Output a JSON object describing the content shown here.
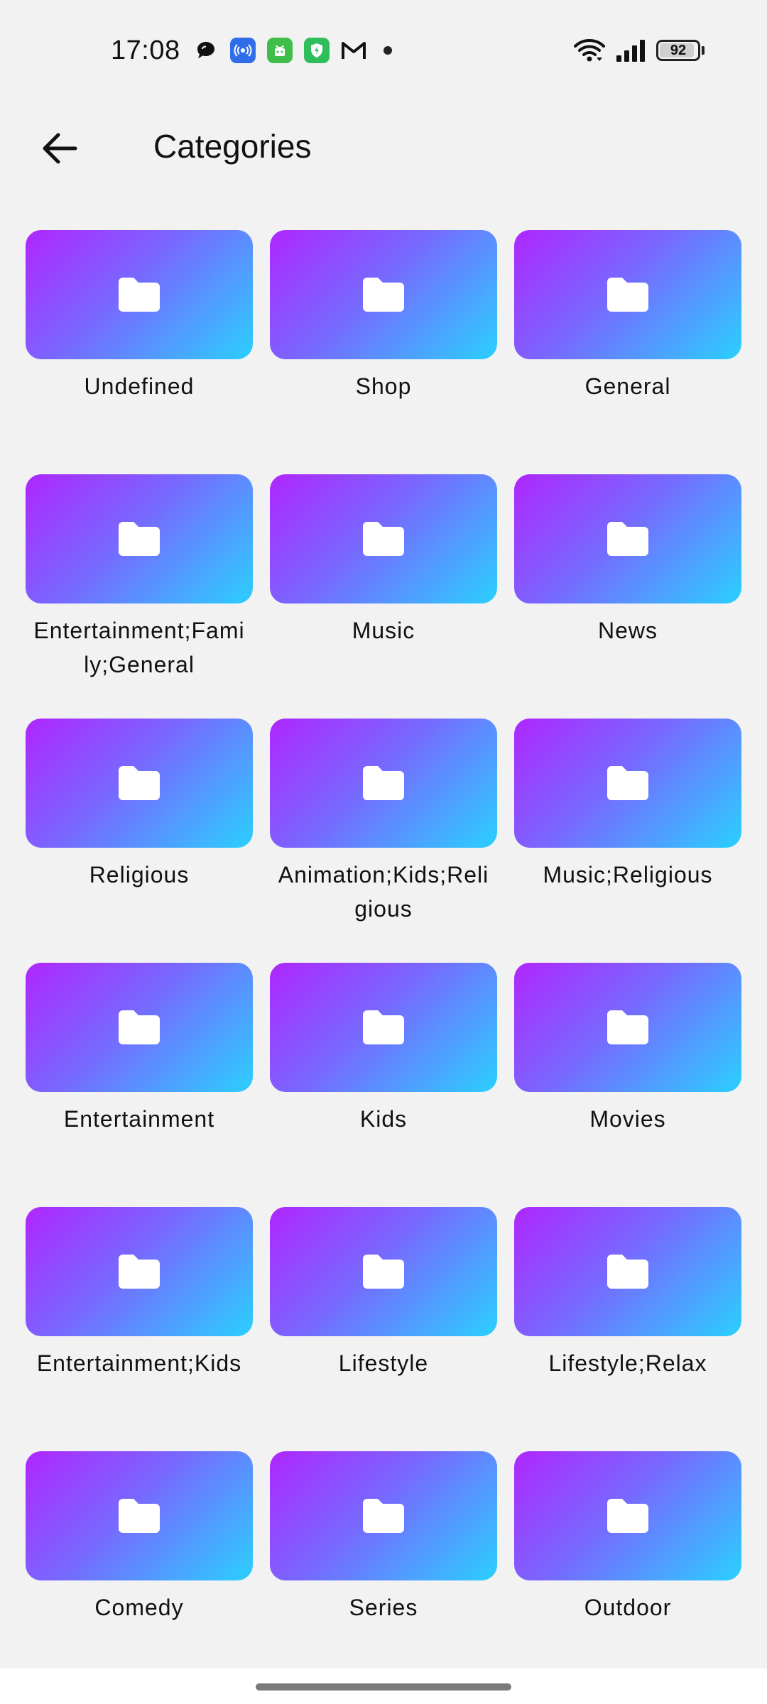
{
  "status_bar": {
    "time": "17:08",
    "battery": "92",
    "battery_level": 0.92,
    "notification_icons": [
      "chat-bubble-icon",
      "broadcast-icon",
      "store-bag-icon",
      "shield-bolt-icon",
      "gmail-icon",
      "more-dot-icon"
    ],
    "system_icons": [
      "wifi-icon",
      "signal-icon",
      "battery-icon"
    ]
  },
  "app_bar": {
    "back_icon": "arrow-left-icon",
    "title": "Categories"
  },
  "theme": {
    "background": "#f2f2f2",
    "gradient_start": "#b026ff",
    "gradient_mid": "#7769ff",
    "gradient_end": "#2ad0ff",
    "folder_icon_color": "#ffffff"
  },
  "categories": [
    {
      "label": "Undefined",
      "icon": "folder-icon"
    },
    {
      "label": "Shop",
      "icon": "folder-icon"
    },
    {
      "label": "General",
      "icon": "folder-icon"
    },
    {
      "label": "Entertainment;Family;General",
      "icon": "folder-icon"
    },
    {
      "label": "Music",
      "icon": "folder-icon"
    },
    {
      "label": "News",
      "icon": "folder-icon"
    },
    {
      "label": "Religious",
      "icon": "folder-icon"
    },
    {
      "label": "Animation;Kids;Religious",
      "icon": "folder-icon"
    },
    {
      "label": "Music;Religious",
      "icon": "folder-icon"
    },
    {
      "label": "Entertainment",
      "icon": "folder-icon"
    },
    {
      "label": "Kids",
      "icon": "folder-icon"
    },
    {
      "label": "Movies",
      "icon": "folder-icon"
    },
    {
      "label": "Entertainment;Kids",
      "icon": "folder-icon"
    },
    {
      "label": "Lifestyle",
      "icon": "folder-icon"
    },
    {
      "label": "Lifestyle;Relax",
      "icon": "folder-icon"
    },
    {
      "label": "Comedy",
      "icon": "folder-icon"
    },
    {
      "label": "Series",
      "icon": "folder-icon"
    },
    {
      "label": "Outdoor",
      "icon": "folder-icon"
    }
  ]
}
